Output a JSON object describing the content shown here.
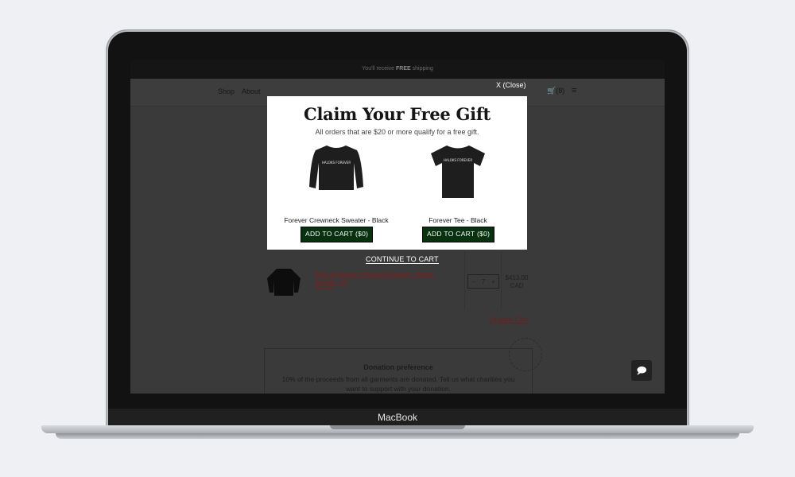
{
  "device": {
    "brand_label": "MacBook"
  },
  "promo_bar": {
    "prefix": "You'll receive",
    "highlight": "FREE",
    "suffix": "shipping"
  },
  "header": {
    "nav": [
      {
        "label": "Shop"
      },
      {
        "label": "About"
      }
    ],
    "cart_label": "(8)"
  },
  "modal": {
    "close_label": "X (Close)",
    "title": "Claim Your Free Gift",
    "subtitle": "All orders that are $20 or more qualify for a free gift.",
    "gifts": [
      {
        "name": "Forever Crewneck Sweater - Black",
        "button_label": "ADD TO CART ($0)",
        "print_text": "HALOKS FOREVER",
        "icon": "sweater-icon"
      },
      {
        "name": "Forever Tee - Black",
        "button_label": "ADD TO CART ($0)",
        "print_text": "HALOKS FOREVER",
        "icon": "tshirt-icon"
      }
    ],
    "continue_label": "CONTINUE TO CART"
  },
  "cart": {
    "item": {
      "name": "Born & Raised Crewneck Sweater - Black | Toronto - M",
      "remove_label": "Remove",
      "quantity": "7",
      "price_line1": "$413.00",
      "price_line2": "CAD"
    },
    "update_label": "Update Cart"
  },
  "donation": {
    "title": "Donation preference",
    "text": "10% of the proceeds from all garments are donated. Tell us what charities you want to support with your donation."
  },
  "colors": {
    "button_green": "#07310f",
    "link_red": "#7a1f1f"
  }
}
